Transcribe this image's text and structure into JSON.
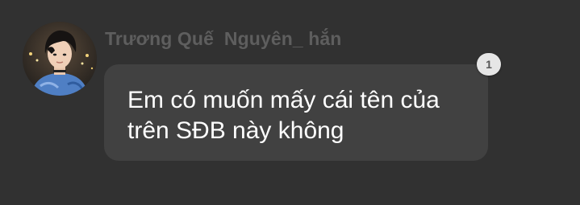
{
  "message": {
    "sender_name": "Trương Quế  Nguyên_ hắn",
    "text": "Em có muốn mấy cái tên của trên SĐB này không",
    "reaction_count": "1"
  },
  "colors": {
    "background": "#313131",
    "bubble": "#414141",
    "sender_name": "#5e5e5e",
    "text": "#ffffff",
    "badge": "#e6e6e6"
  },
  "icons": {
    "avatar": "user-avatar-photo"
  }
}
